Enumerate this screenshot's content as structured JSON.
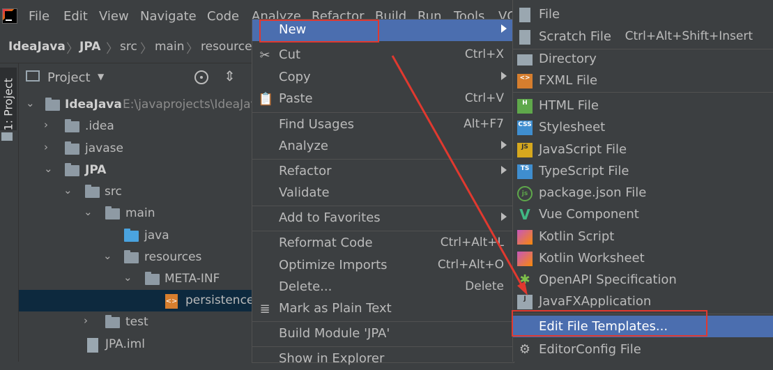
{
  "menubar": {
    "items": [
      "File",
      "Edit",
      "View",
      "Navigate",
      "Code",
      "Analyze",
      "Refactor",
      "Build",
      "Run",
      "Tools",
      "VC"
    ]
  },
  "breadcrumb": [
    "IdeaJava",
    "JPA",
    "src",
    "main",
    "resources"
  ],
  "left_strip": {
    "tab_label": "1: Project"
  },
  "project_panel": {
    "title": "Project",
    "tree": [
      {
        "label": "IdeaJava",
        "path": "E:\\javaprojects\\IdeaJav"
      },
      {
        "label": ".idea"
      },
      {
        "label": "javase"
      },
      {
        "label": "JPA"
      },
      {
        "label": "src"
      },
      {
        "label": "main"
      },
      {
        "label": "java"
      },
      {
        "label": "resources"
      },
      {
        "label": "META-INF"
      },
      {
        "label": "persistence."
      },
      {
        "label": "test"
      },
      {
        "label": "JPA.iml"
      }
    ]
  },
  "context_menu": {
    "items": [
      {
        "label": "New"
      },
      {
        "label": "Cut",
        "shortcut": "Ctrl+X"
      },
      {
        "label": "Copy"
      },
      {
        "label": "Paste",
        "shortcut": "Ctrl+V"
      },
      {
        "label": "Find Usages",
        "shortcut": "Alt+F7"
      },
      {
        "label": "Analyze"
      },
      {
        "label": "Refactor"
      },
      {
        "label": "Validate"
      },
      {
        "label": "Add to Favorites"
      },
      {
        "label": "Reformat Code",
        "shortcut": "Ctrl+Alt+L"
      },
      {
        "label": "Optimize Imports",
        "shortcut": "Ctrl+Alt+O"
      },
      {
        "label": "Delete...",
        "shortcut": "Delete"
      },
      {
        "label": "Mark as Plain Text"
      },
      {
        "label": "Build Module 'JPA'"
      },
      {
        "label": "Show in Explorer"
      }
    ]
  },
  "new_submenu": {
    "items": [
      {
        "label": "File"
      },
      {
        "label": "Scratch File",
        "shortcut": "Ctrl+Alt+Shift+Insert"
      },
      {
        "label": "Directory"
      },
      {
        "label": "FXML File"
      },
      {
        "label": "HTML File"
      },
      {
        "label": "Stylesheet"
      },
      {
        "label": "JavaScript File"
      },
      {
        "label": "TypeScript File"
      },
      {
        "label": "package.json File"
      },
      {
        "label": "Vue Component"
      },
      {
        "label": "Kotlin Script"
      },
      {
        "label": "Kotlin Worksheet"
      },
      {
        "label": "OpenAPI Specification"
      },
      {
        "label": "JavaFXApplication"
      },
      {
        "label": "Edit File Templates..."
      },
      {
        "label": "EditorConfig File"
      }
    ]
  },
  "colors": {
    "background": "#3c3f41",
    "highlight": "#4b6eaf",
    "selection": "#0d293e",
    "annotation": "#e0392f"
  }
}
